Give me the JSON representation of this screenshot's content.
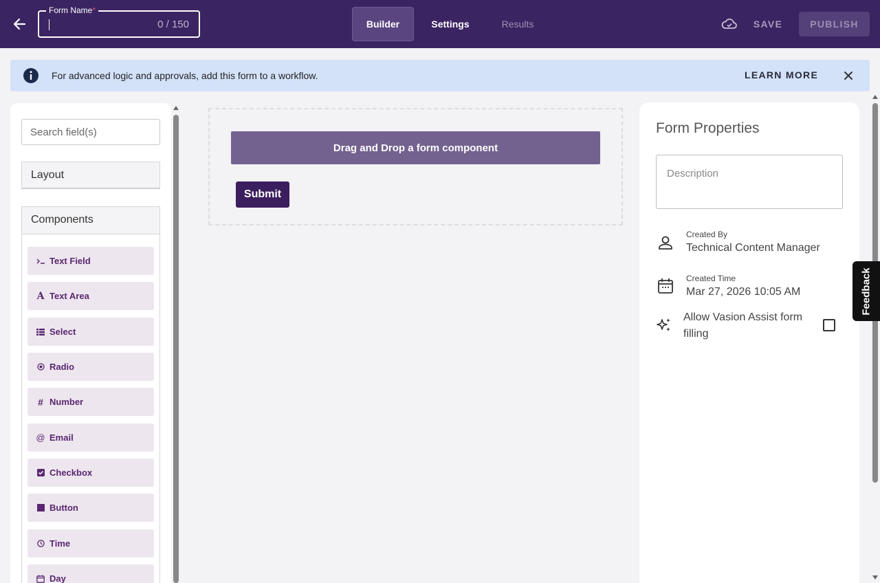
{
  "header": {
    "form_name_label": "Form Name",
    "form_name_required": "*",
    "form_name_value": "",
    "form_name_counter": "0 / 150",
    "tabs": [
      {
        "label": "Builder"
      },
      {
        "label": "Settings"
      },
      {
        "label": "Results"
      }
    ],
    "save_label": "SAVE",
    "publish_label": "PUBLISH",
    "colors": {
      "bar": "#3b2462",
      "active_tab": "#5a4580"
    }
  },
  "banner": {
    "text": "For advanced logic and approvals, add this form to a workflow.",
    "learn_more": "LEARN MORE",
    "background": "#d3e2f9"
  },
  "sidebar": {
    "search_placeholder": "Search field(s)",
    "layout_label": "Layout",
    "components_label": "Components",
    "components": [
      {
        "label": "Text Field",
        "icon": "terminal-icon"
      },
      {
        "label": "Text Area",
        "icon": "font-a-icon"
      },
      {
        "label": "Select",
        "icon": "list-icon"
      },
      {
        "label": "Radio",
        "icon": "radio-icon"
      },
      {
        "label": "Number",
        "icon": "hash-icon"
      },
      {
        "label": "Email",
        "icon": "at-icon"
      },
      {
        "label": "Checkbox",
        "icon": "checkbox-icon"
      },
      {
        "label": "Button",
        "icon": "square-icon"
      },
      {
        "label": "Time",
        "icon": "clock-icon"
      },
      {
        "label": "Day",
        "icon": "calendar-icon"
      }
    ]
  },
  "canvas": {
    "drop_zone_text": "Drag and Drop a form component",
    "submit_label": "Submit"
  },
  "properties": {
    "title": "Form Properties",
    "description_placeholder": "Description",
    "created_by_label": "Created By",
    "created_by_value": "Technical Content Manager",
    "created_time_label": "Created Time",
    "created_time_value": "Mar 27, 2026 10:05 AM",
    "assist_label": "Allow Vasion Assist form filling",
    "assist_checked": false
  },
  "feedback_label": "Feedback"
}
